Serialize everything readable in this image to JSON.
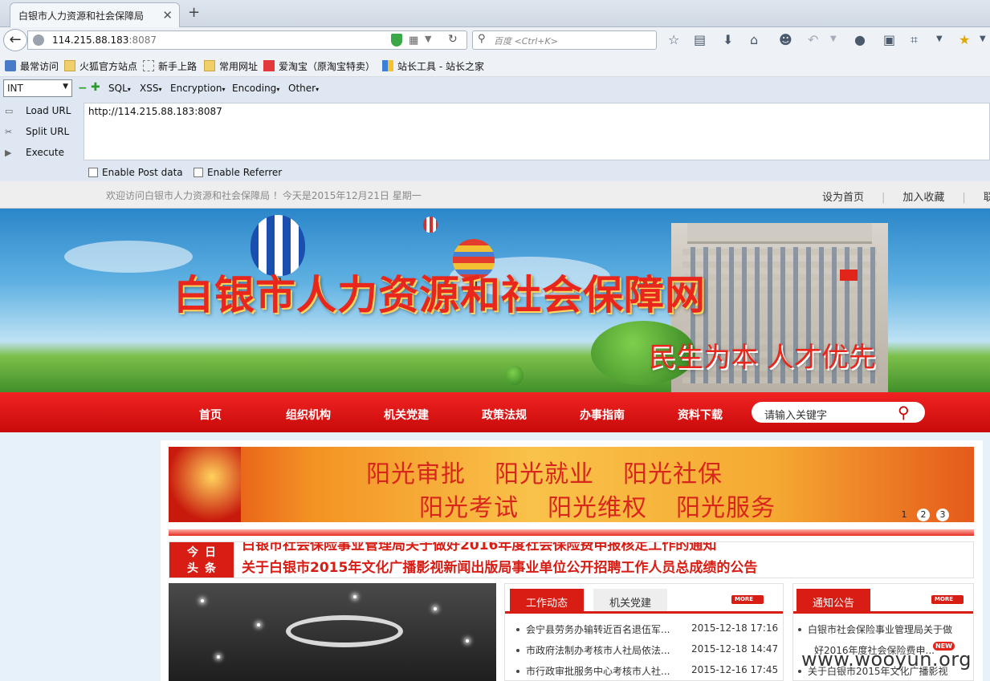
{
  "browser": {
    "tab_title": "白银市人力资源和社会保障局",
    "tab_close": "✕",
    "new_tab": "+",
    "url_host": "114.215.88.183",
    "url_port": ":8087",
    "search_placeholder": "百度 <Ctrl+K>",
    "toolbar_icons": [
      "star-icon",
      "reading-list-icon",
      "download-icon",
      "home-icon",
      "chat-icon",
      "undo-icon",
      "comment-icon",
      "reader-icon",
      "crop-icon",
      "menu-icon",
      "addon-icon"
    ]
  },
  "bookmarks": [
    {
      "label": "最常访问"
    },
    {
      "label": "火狐官方站点"
    },
    {
      "label": "新手上路"
    },
    {
      "label": "常用网址"
    },
    {
      "label": "爱淘宝（原淘宝特卖）"
    },
    {
      "label": "站长工具 - 站长之家"
    }
  ],
  "hackbar": {
    "select_value": "INT",
    "menus": [
      "SQL",
      "XSS",
      "Encryption",
      "Encoding",
      "Other"
    ],
    "actions": [
      "Load URL",
      "Split URL",
      "Execute"
    ],
    "url_value": "http://114.215.88.183:8087",
    "checkbox_post": "Enable Post data",
    "checkbox_referrer": "Enable Referrer"
  },
  "site": {
    "welcome": "欢迎访问白银市人力资源和社会保障局 ！今天是2015年12月21日   星期一",
    "toplinks": [
      "设为首页",
      "加入收藏",
      "联系我"
    ],
    "title": "白银市人力资源和社会保障网",
    "slogan": "民生为本  人才优先",
    "nav": [
      "首页",
      "组织机构",
      "机关党建",
      "政策法规",
      "办事指南",
      "资料下载"
    ],
    "search_placeholder": "请输入关键字",
    "sun_row1": [
      "阳光审批",
      "阳光就业",
      "阳光社保"
    ],
    "sun_row2": [
      "阳光考试",
      "阳光维权",
      "阳光服务"
    ],
    "pager": [
      "1",
      "2",
      "3"
    ],
    "headline_tag_top": "今日",
    "headline_tag_bottom": "头条",
    "headline_1": "白银市社会保险事业管理局关于做好2016年度社会保险费申报核定工作的通知",
    "headline_2": "关于白银市2015年文化广播影视新闻出版局事业单位公开招聘工作人员总成绩的公告",
    "work_tab_active": "工作动态",
    "work_tab_inactive": "机关党建",
    "more_label": "MORE",
    "work_news": [
      {
        "title": "会宁县劳务办输转近百名退伍军...",
        "date": "2015-12-18 17:16"
      },
      {
        "title": "市政府法制办考核市人社局依法...",
        "date": "2015-12-18 14:47"
      },
      {
        "title": "市行政审批服务中心考核市人社...",
        "date": "2015-12-16 17:45"
      }
    ],
    "notice_tab": "通知公告",
    "notice_news": [
      {
        "title": "白银市社会保险事业管理局关于做"
      },
      {
        "title": "好2016年度社会保险费申..."
      },
      {
        "title": "关于白银市2015年文化广播影视"
      }
    ],
    "new_badge": "NEW"
  },
  "watermark": "www.wooyun.org"
}
